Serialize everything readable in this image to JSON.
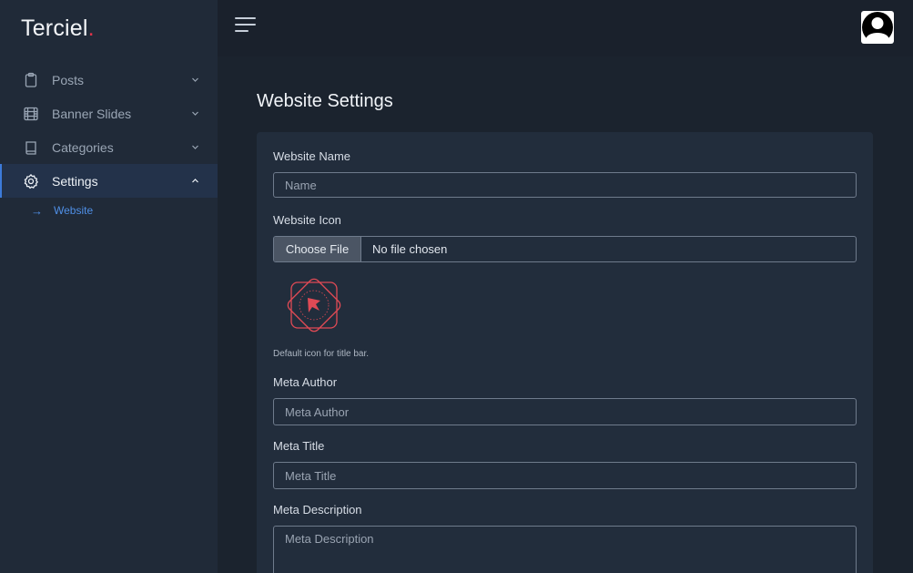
{
  "brand": {
    "name": "Terciel",
    "dot": "."
  },
  "sidebar": {
    "items": [
      {
        "label": "Posts",
        "icon": "clipboard-icon"
      },
      {
        "label": "Banner Slides",
        "icon": "film-icon"
      },
      {
        "label": "Categories",
        "icon": "book-icon"
      },
      {
        "label": "Settings",
        "icon": "gear-icon"
      }
    ],
    "sub_items": [
      {
        "arrow": "→",
        "label": "Website"
      }
    ]
  },
  "page": {
    "title": "Website Settings"
  },
  "form": {
    "website_name": {
      "label": "Website Name",
      "placeholder": "Name"
    },
    "website_icon": {
      "label": "Website Icon",
      "button": "Choose File",
      "status": "No file chosen",
      "help": "Default icon for title bar."
    },
    "meta_author": {
      "label": "Meta Author",
      "placeholder": "Meta Author"
    },
    "meta_title": {
      "label": "Meta Title",
      "placeholder": "Meta Title"
    },
    "meta_description": {
      "label": "Meta Description",
      "placeholder": "Meta Description"
    }
  },
  "colors": {
    "accent": "#3d7bd9",
    "brand_dot": "#e0334a",
    "logo": "#e04a55"
  }
}
